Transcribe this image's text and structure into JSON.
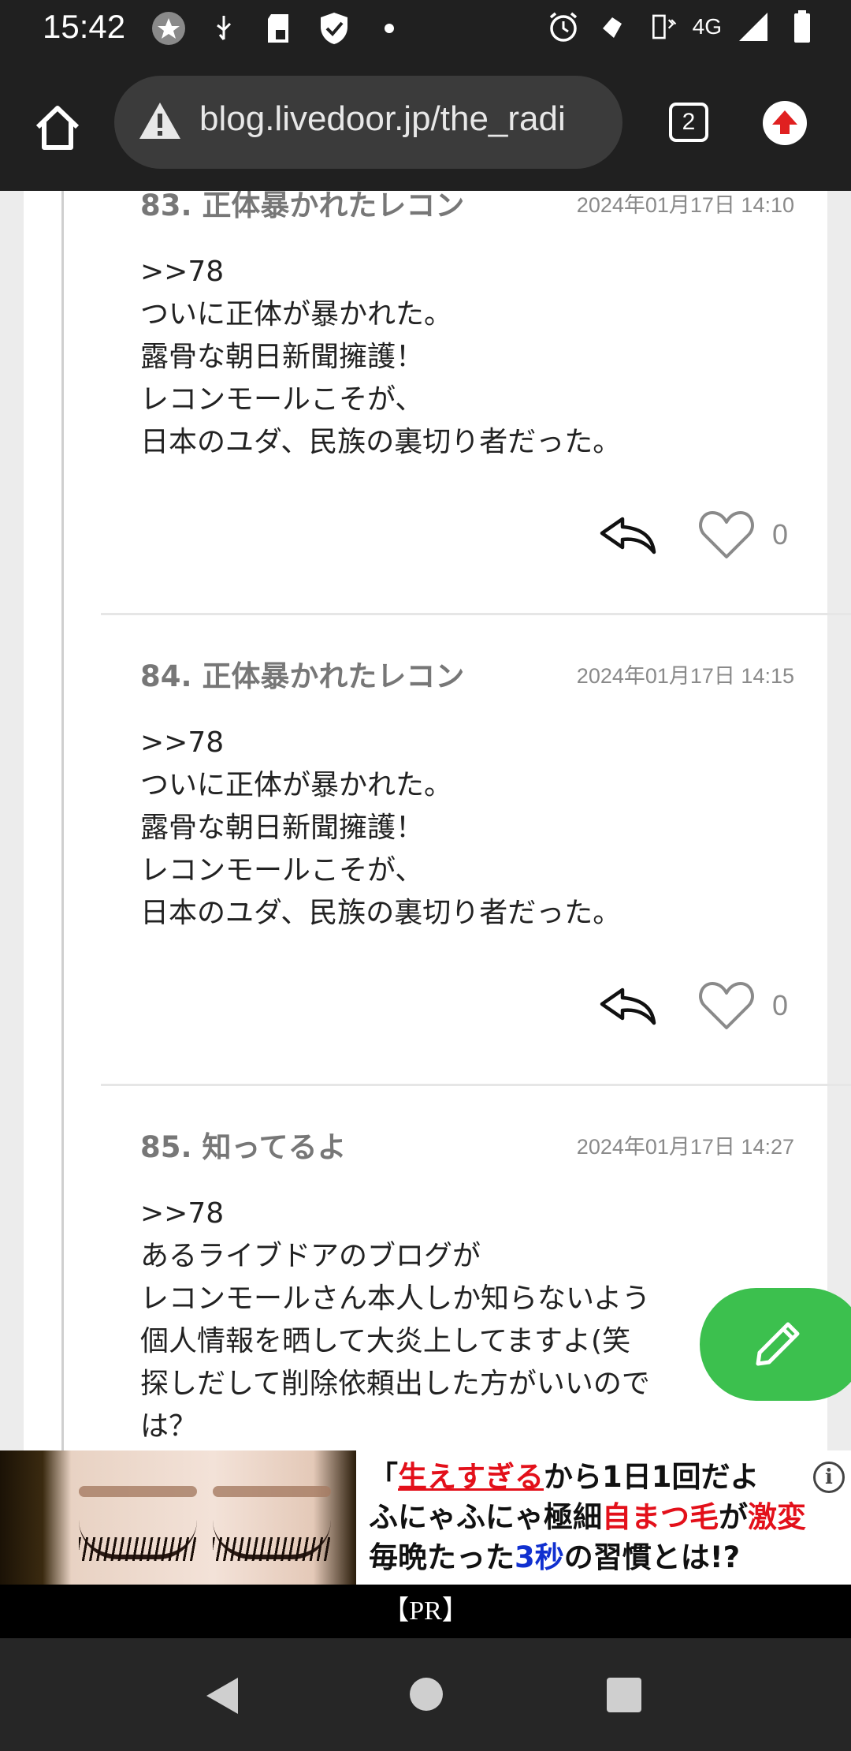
{
  "status_bar": {
    "time": "15:42",
    "network": "4G",
    "icons_left": [
      "star-badge-icon",
      "usb-icon",
      "sd-card-icon",
      "shield-icon",
      "dot-icon"
    ],
    "icons_right": [
      "alarm-icon",
      "data-saver-icon",
      "vibrate-icon",
      "signal-icon",
      "battery-icon"
    ]
  },
  "browser": {
    "url": "blog.livedoor.jp/the_radi",
    "tab_count": "2",
    "icons": [
      "home-icon",
      "warning-icon",
      "tabs-icon",
      "update-arrow-icon"
    ]
  },
  "comments": [
    {
      "number": "83.",
      "name": "正体暴かれたレコン",
      "date": "2024年01月17日 14:10",
      "body": ">>78\nついに正体が暴かれた。\n露骨な朝日新聞擁護！\nレコンモールこそが、\n日本のユダ、民族の裏切り者だった。",
      "likes": "0"
    },
    {
      "number": "84.",
      "name": "正体暴かれたレコン",
      "date": "2024年01月17日 14:15",
      "body": ">>78\nついに正体が暴かれた。\n露骨な朝日新聞擁護！\nレコンモールこそが、\n日本のユダ、民族の裏切り者だった。",
      "likes": "0"
    },
    {
      "number": "85.",
      "name": "知ってるよ",
      "date": "2024年01月17日 14:27",
      "body": ">>78\nあるライブドアのブログが\nレコンモールさん本人しか知らないよう\n個人情報を晒して大炎上してますよ(笑\n探しだして削除依頼出した方がいいので\nは？",
      "likes": ""
    }
  ],
  "fab": {
    "icon": "pencil-icon"
  },
  "ad": {
    "line1": {
      "a": "「",
      "b": "生えすぎる",
      "c": "から1日1回だよ"
    },
    "line2": {
      "a": "ふにゃふにゃ極細",
      "b": "自まつ毛",
      "c": "が",
      "d": "激変"
    },
    "line3": {
      "a": "毎晩たった",
      "b": "3秒",
      "c": "の習慣とは!?"
    },
    "info": "i",
    "pr": "【PR】"
  },
  "nav": {
    "icons": [
      "back-icon",
      "home-circle-icon",
      "recents-icon"
    ]
  }
}
